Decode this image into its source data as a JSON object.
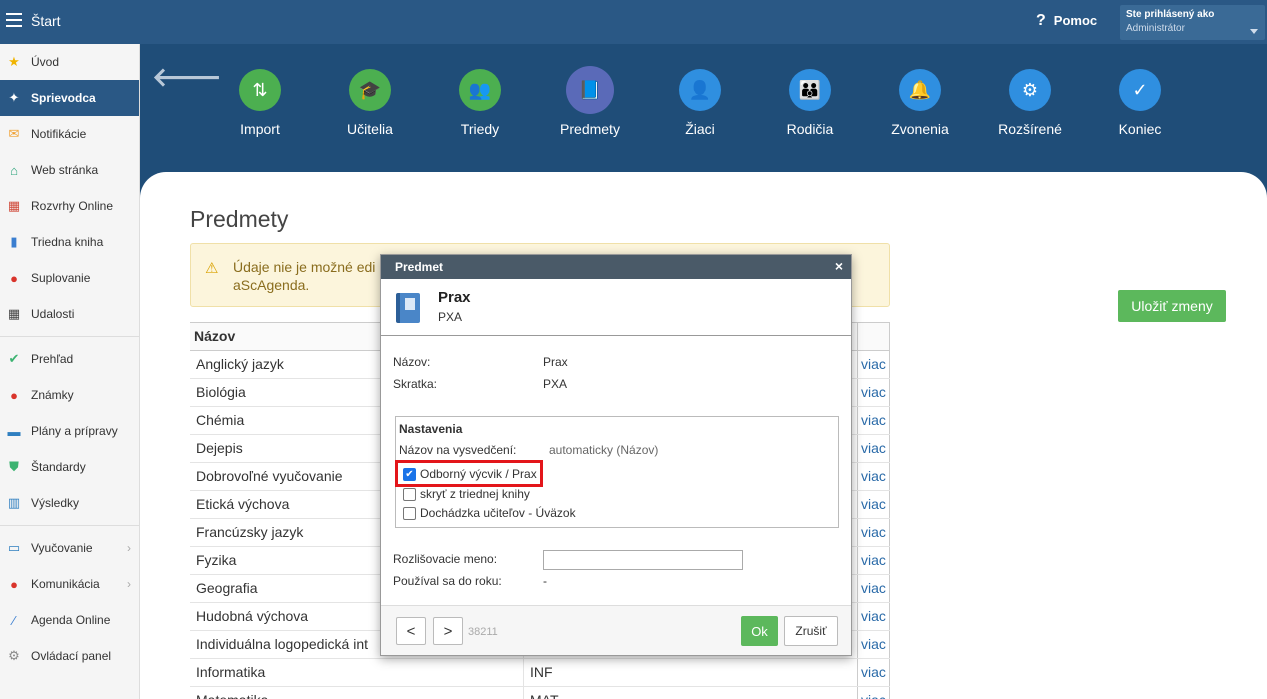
{
  "topbar": {
    "title": "Štart",
    "help": "Pomoc",
    "user_line1": "Ste prihlásený ako",
    "user_line2": "Administrátor"
  },
  "sidebar": {
    "items": [
      {
        "label": "Úvod",
        "icon": "star-icon",
        "color": "#f0b400"
      },
      {
        "label": "Sprievodca",
        "icon": "magic-wand-icon",
        "color": "#ffffff",
        "active": true
      },
      {
        "label": "Notifikácie",
        "icon": "envelope-icon",
        "color": "#f0a030"
      },
      {
        "label": "Web stránka",
        "icon": "home-icon",
        "color": "#2aa37a"
      },
      {
        "label": "Rozvrhy Online",
        "icon": "grid-icon",
        "color": "#d04a3a"
      },
      {
        "label": "Triedna kniha",
        "icon": "book-icon",
        "color": "#3a7ed0"
      },
      {
        "label": "Suplovanie",
        "icon": "person-icon",
        "color": "#d9342b"
      },
      {
        "label": "Udalosti",
        "icon": "calendar-icon",
        "color": "#444444"
      },
      {
        "label": "Prehľad",
        "icon": "check-circle-icon",
        "color": "#3cb371"
      },
      {
        "label": "Známky",
        "icon": "grade-icon",
        "color": "#d9342b"
      },
      {
        "label": "Plány a prípravy",
        "icon": "briefcase-icon",
        "color": "#2f7fc0"
      },
      {
        "label": "Štandardy",
        "icon": "shield-icon",
        "color": "#3cb371"
      },
      {
        "label": "Výsledky",
        "icon": "bar-chart-icon",
        "color": "#2f7fc0"
      },
      {
        "label": "Vyučovanie",
        "icon": "open-book-icon",
        "color": "#2f7fc0"
      },
      {
        "label": "Komunikácia",
        "icon": "chat-icon",
        "color": "#d9342b"
      },
      {
        "label": "Agenda Online",
        "icon": "paperclip-icon",
        "color": "#3a7ed0"
      },
      {
        "label": "Ovládací panel",
        "icon": "gear-icon",
        "color": "#888888"
      }
    ]
  },
  "steps": [
    {
      "label": "Import",
      "icon": "import-icon",
      "glyph": "⇅",
      "color": "#4caf50"
    },
    {
      "label": "Učitelia",
      "icon": "graduation-cap-icon",
      "glyph": "🎓",
      "color": "#4caf50"
    },
    {
      "label": "Triedy",
      "icon": "group-icon",
      "glyph": "👥",
      "color": "#4caf50"
    },
    {
      "label": "Predmety",
      "icon": "book-icon",
      "glyph": "📘",
      "color": "#5a6ab8",
      "active": true
    },
    {
      "label": "Žiaci",
      "icon": "person-icon",
      "glyph": "👤",
      "color": "#2f8fe0"
    },
    {
      "label": "Rodičia",
      "icon": "parents-icon",
      "glyph": "👪",
      "color": "#2f8fe0"
    },
    {
      "label": "Zvonenia",
      "icon": "bell-icon",
      "glyph": "🔔",
      "color": "#2f8fe0"
    },
    {
      "label": "Rozšírené",
      "icon": "gear-icon",
      "glyph": "⚙",
      "color": "#2f8fe0"
    },
    {
      "label": "Koniec",
      "icon": "check-icon",
      "glyph": "✓",
      "color": "#2f8fe0"
    }
  ],
  "page": {
    "title": "Predmety",
    "warning": "Údaje nie je možné edi aScAgenda.",
    "save_button": "Uložiť zmeny"
  },
  "table": {
    "header": "Názov",
    "rows": [
      {
        "name": "Anglický jazyk",
        "abbr": "",
        "more": "viac"
      },
      {
        "name": "Biológia",
        "abbr": "",
        "more": "viac"
      },
      {
        "name": "Chémia",
        "abbr": "",
        "more": "viac"
      },
      {
        "name": "Dejepis",
        "abbr": "",
        "more": "viac"
      },
      {
        "name": "Dobrovoľné vyučovanie",
        "abbr": "",
        "more": "viac"
      },
      {
        "name": "Etická výchova",
        "abbr": "",
        "more": "viac"
      },
      {
        "name": "Francúzsky jazyk",
        "abbr": "",
        "more": "viac"
      },
      {
        "name": "Fyzika",
        "abbr": "",
        "more": "viac"
      },
      {
        "name": "Geografia",
        "abbr": "",
        "more": "viac"
      },
      {
        "name": "Hudobná výchova",
        "abbr": "",
        "more": "viac"
      },
      {
        "name": "Individuálna logopedická int",
        "abbr": "",
        "more": "viac"
      },
      {
        "name": "Informatika",
        "abbr": "INF",
        "more": "viac"
      },
      {
        "name": "Matematika",
        "abbr": "MAT",
        "more": "viac"
      }
    ]
  },
  "dialog": {
    "title": "Predmet",
    "close": "×",
    "subject_name": "Prax",
    "subject_abbr": "PXA",
    "name_label": "Názov:",
    "name_value": "Prax",
    "abbr_label": "Skratka:",
    "abbr_value": "PXA",
    "settings_legend": "Nastavenia",
    "cert_name_label": "Názov na vysvedčení:",
    "cert_name_value": "automaticky (Názov)",
    "checkbox_vocational": "Odborný výcvik / Prax",
    "checkbox_vocational_checked": true,
    "checkbox_hide": "skryť z triednej knihy",
    "checkbox_attendance": "Dochádzka učiteľov - Úväzok",
    "distinguish_label": "Rozlišovacie meno:",
    "distinguish_value": "",
    "used_until_label": "Používal sa do roku:",
    "used_until_value": "-",
    "prev": "<",
    "next": ">",
    "record_id": "38211",
    "ok": "Ok",
    "cancel": "Zrušiť"
  }
}
